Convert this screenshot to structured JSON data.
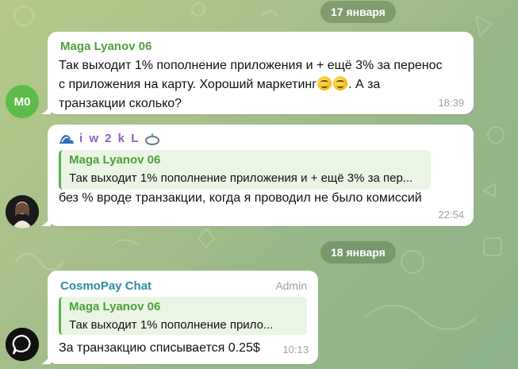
{
  "dates": [
    "17 января",
    "18 января"
  ],
  "messages": [
    {
      "avatar_initials": "M0",
      "sender": "Maga Lyanov 06",
      "lines": [
        "Так выходит 1% пополнение приложения и + ещё 3% за перенос",
        "с приложения на карту. Хороший маркетинг",
        ". А за",
        "транзакции сколько?"
      ],
      "emoji": [
        "smiling-face-icon",
        "smiling-face-icon"
      ],
      "time": "18:39"
    },
    {
      "sender": "i w 2 k L",
      "reply": {
        "name": "Maga Lyanov 06",
        "text": "Так выходит 1% пополнение приложения и + ещё 3% за пер..."
      },
      "text": "без % вроде транзакции, когда я проводил не было комиссий",
      "time": "22:54"
    },
    {
      "sender": "CosmoPay Chat",
      "badge": "Admin",
      "reply": {
        "name": "Maga Lyanov 06",
        "text": "Так выходит 1% пополнение прило..."
      },
      "text": "За транзакцию списывается 0.25$",
      "time": "10:13"
    }
  ],
  "colors": {
    "sender_green": "#4e9f3d",
    "sender_teal": "#2f8ba8",
    "avatar_green": "#5dbb4c",
    "reply_bar": "#59b04a"
  }
}
